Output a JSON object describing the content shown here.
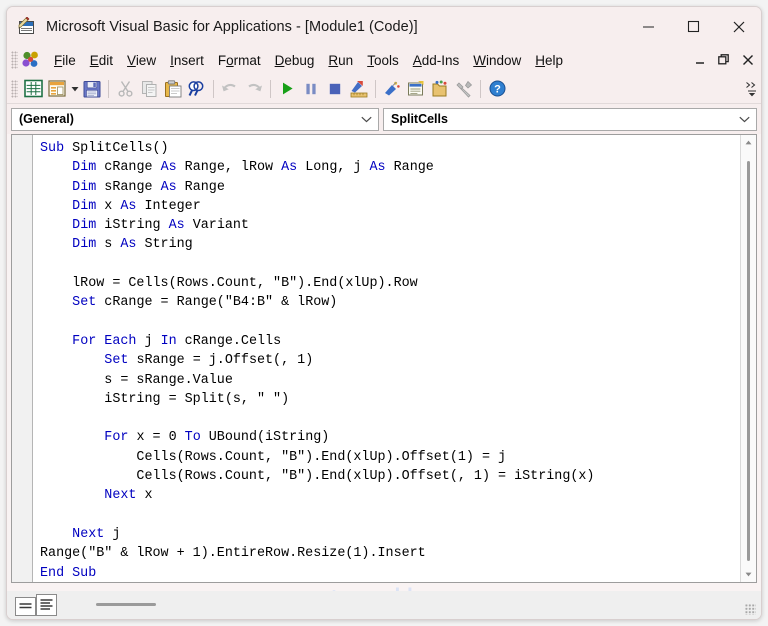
{
  "window": {
    "title": "Microsoft Visual Basic for Applications - [Module1 (Code)]",
    "app_icon": "vba-module-icon",
    "minimize_label": "Minimize",
    "maximize_label": "Maximize",
    "close_label": "Close"
  },
  "menubar": {
    "logo_icon": "vba-logo-icon",
    "items": [
      {
        "label": "File",
        "accel": "F"
      },
      {
        "label": "Edit",
        "accel": "E"
      },
      {
        "label": "View",
        "accel": "V"
      },
      {
        "label": "Insert",
        "accel": "I"
      },
      {
        "label": "Format",
        "accel": "o"
      },
      {
        "label": "Debug",
        "accel": "D"
      },
      {
        "label": "Run",
        "accel": "R"
      },
      {
        "label": "Tools",
        "accel": "T"
      },
      {
        "label": "Add-Ins",
        "accel": "A"
      },
      {
        "label": "Window",
        "accel": "W"
      },
      {
        "label": "Help",
        "accel": "H"
      }
    ],
    "mdi_minimize": "_",
    "mdi_restore": "restore",
    "mdi_close": "×"
  },
  "toolbar": {
    "items": [
      {
        "name": "view-excel-icon",
        "tooltip": "View Microsoft Excel"
      },
      {
        "name": "insert-module-icon",
        "tooltip": "Insert"
      },
      {
        "name": "insert-dropdown-arrow",
        "tooltip": "Insert options"
      },
      {
        "name": "save-icon",
        "tooltip": "Save"
      },
      {
        "name": "cut-icon",
        "tooltip": "Cut"
      },
      {
        "name": "copy-icon",
        "tooltip": "Copy"
      },
      {
        "name": "paste-icon",
        "tooltip": "Paste"
      },
      {
        "name": "find-icon",
        "tooltip": "Find"
      },
      {
        "name": "undo-icon",
        "tooltip": "Undo"
      },
      {
        "name": "redo-icon",
        "tooltip": "Redo"
      },
      {
        "name": "run-icon",
        "tooltip": "Run Sub/UserForm"
      },
      {
        "name": "pause-icon",
        "tooltip": "Break"
      },
      {
        "name": "stop-icon",
        "tooltip": "Reset"
      },
      {
        "name": "design-mode-icon",
        "tooltip": "Design Mode"
      },
      {
        "name": "project-explorer-icon",
        "tooltip": "Project Explorer"
      },
      {
        "name": "properties-window-icon",
        "tooltip": "Properties Window"
      },
      {
        "name": "object-browser-icon",
        "tooltip": "Object Browser"
      },
      {
        "name": "toolbox-icon",
        "tooltip": "Toolbox"
      },
      {
        "name": "help-icon",
        "tooltip": "Help"
      }
    ],
    "overflow_label": "More buttons"
  },
  "combos": {
    "object": {
      "value": "(General)",
      "caret_icon": "chevron-down-icon"
    },
    "procedure": {
      "value": "SplitCells",
      "caret_icon": "chevron-down-icon"
    }
  },
  "code": {
    "lines": [
      [
        {
          "t": "Sub",
          "k": true
        },
        {
          "t": " SplitCells()"
        }
      ],
      [
        {
          "t": "    "
        },
        {
          "t": "Dim",
          "k": true
        },
        {
          "t": " cRange "
        },
        {
          "t": "As",
          "k": true
        },
        {
          "t": " Range, lRow "
        },
        {
          "t": "As",
          "k": true
        },
        {
          "t": " Long, j "
        },
        {
          "t": "As",
          "k": true
        },
        {
          "t": " Range"
        }
      ],
      [
        {
          "t": "    "
        },
        {
          "t": "Dim",
          "k": true
        },
        {
          "t": " sRange "
        },
        {
          "t": "As",
          "k": true
        },
        {
          "t": " Range"
        }
      ],
      [
        {
          "t": "    "
        },
        {
          "t": "Dim",
          "k": true
        },
        {
          "t": " x "
        },
        {
          "t": "As",
          "k": true
        },
        {
          "t": " Integer"
        }
      ],
      [
        {
          "t": "    "
        },
        {
          "t": "Dim",
          "k": true
        },
        {
          "t": " iString "
        },
        {
          "t": "As",
          "k": true
        },
        {
          "t": " Variant"
        }
      ],
      [
        {
          "t": "    "
        },
        {
          "t": "Dim",
          "k": true
        },
        {
          "t": " s "
        },
        {
          "t": "As",
          "k": true
        },
        {
          "t": " String"
        }
      ],
      [
        {
          "t": ""
        }
      ],
      [
        {
          "t": "    lRow = Cells(Rows.Count, \"B\").End(xlUp).Row"
        }
      ],
      [
        {
          "t": "    "
        },
        {
          "t": "Set",
          "k": true
        },
        {
          "t": " cRange = Range(\"B4:B\" & lRow)"
        }
      ],
      [
        {
          "t": ""
        }
      ],
      [
        {
          "t": "    "
        },
        {
          "t": "For Each",
          "k": true
        },
        {
          "t": " j "
        },
        {
          "t": "In",
          "k": true
        },
        {
          "t": " cRange.Cells"
        }
      ],
      [
        {
          "t": "        "
        },
        {
          "t": "Set",
          "k": true
        },
        {
          "t": " sRange = j.Offset(, 1)"
        }
      ],
      [
        {
          "t": "        s = sRange.Value"
        }
      ],
      [
        {
          "t": "        iString = Split(s, \" \")"
        }
      ],
      [
        {
          "t": ""
        }
      ],
      [
        {
          "t": "        "
        },
        {
          "t": "For",
          "k": true
        },
        {
          "t": " x = 0 "
        },
        {
          "t": "To",
          "k": true
        },
        {
          "t": " UBound(iString)"
        }
      ],
      [
        {
          "t": "            Cells(Rows.Count, \"B\").End(xlUp).Offset(1) = j"
        }
      ],
      [
        {
          "t": "            Cells(Rows.Count, \"B\").End(xlUp).Offset(, 1) = iString(x)"
        }
      ],
      [
        {
          "t": "        "
        },
        {
          "t": "Next",
          "k": true
        },
        {
          "t": " x"
        }
      ],
      [
        {
          "t": ""
        }
      ],
      [
        {
          "t": "    "
        },
        {
          "t": "Next",
          "k": true
        },
        {
          "t": " j"
        }
      ],
      [
        {
          "t": "Range(\"B\" & lRow + 1).EntireRow.Resize(1).Insert"
        }
      ],
      [
        {
          "t": "End Sub",
          "k": true
        }
      ]
    ],
    "keyword_color": "#0000C0",
    "text_color": "#000000",
    "background": "#FFFFFF"
  },
  "watermark": {
    "brand": "exceldemy",
    "tagline": "EXCEL · DATA · BI",
    "logo_icon": "exceldemy-cube-icon"
  },
  "bottombar": {
    "procedure_view_icon": "procedure-view-icon",
    "full_module_view_icon": "full-module-view-icon",
    "hscroll_name": "horizontal-scrollbar",
    "resize_grip": "resize-grip"
  },
  "scrollbars": {
    "vertical_name": "code-vertical-scrollbar",
    "up_icon": "scroll-up-icon",
    "down_icon": "scroll-down-icon"
  }
}
